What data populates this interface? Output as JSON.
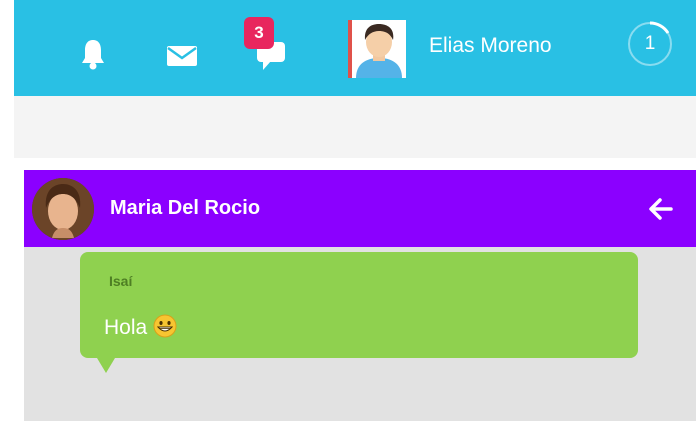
{
  "navbar": {
    "icons": [
      "bell-icon",
      "envelope-icon",
      "chat-icon"
    ],
    "chat_badge": "3",
    "user_name": "Elias Moreno",
    "counter": "1",
    "colors": {
      "bar": "#29c0e4",
      "badge": "#e8265e"
    }
  },
  "chat": {
    "contact_name": "Maria Del Rocio",
    "header_color": "#8b00ff",
    "back_icon": "arrow-left-icon",
    "messages": [
      {
        "sender": "Isaí",
        "text": "Hola",
        "emoji": "grinning-face-emoji",
        "bubble_color": "#8fd14f"
      }
    ]
  }
}
